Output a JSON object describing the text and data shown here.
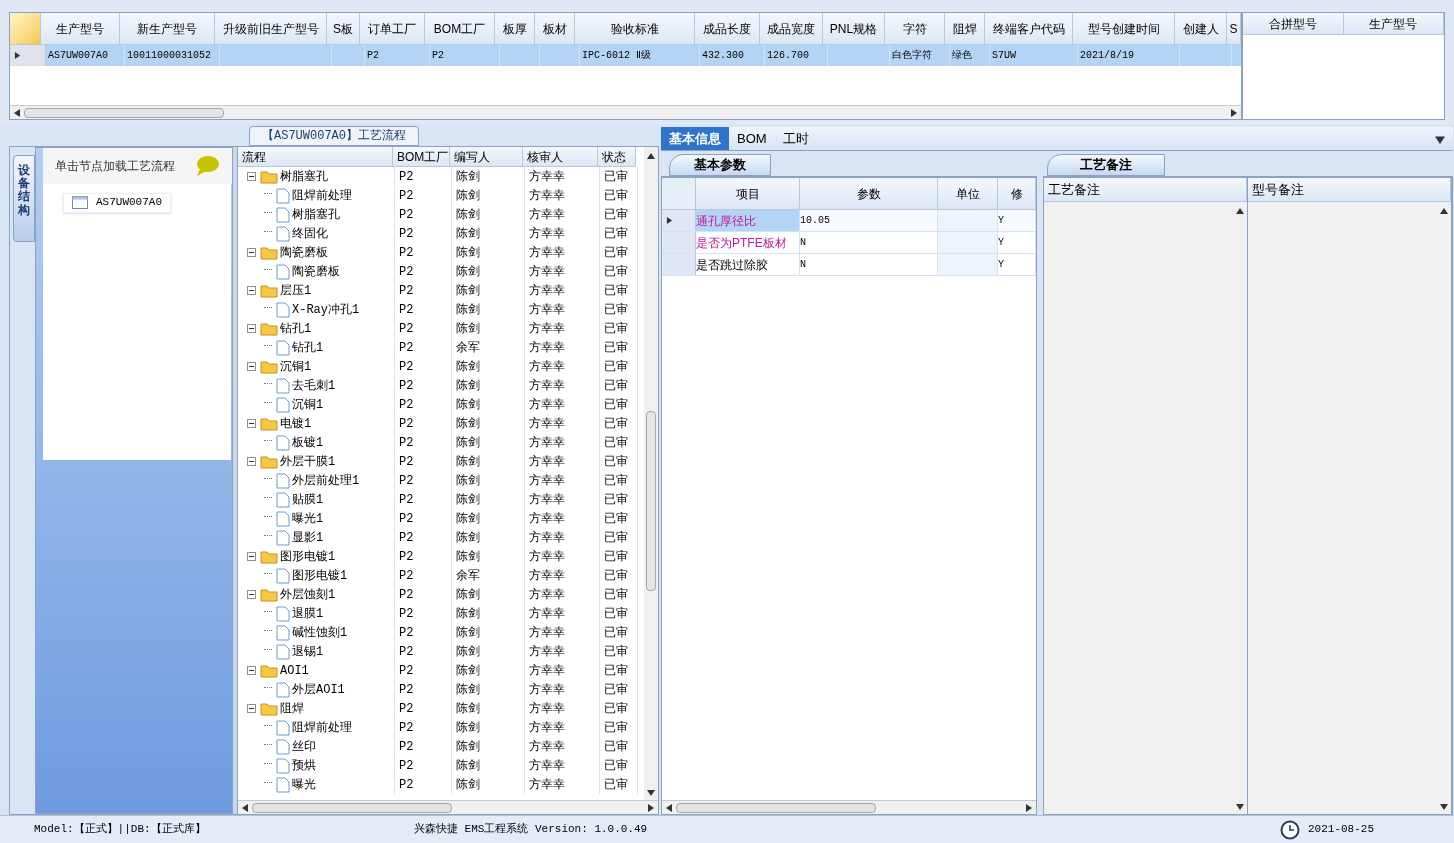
{
  "main_grid": {
    "columns": [
      "生产型号",
      "新生产型号",
      "升级前旧生产型号",
      "S板",
      "订单工厂",
      "BOM工厂",
      "板厚",
      "板材",
      "验收标准",
      "成品长度",
      "成品宽度",
      "PNL规格",
      "字符",
      "阻焊",
      "终端客户代码",
      "型号创建时间",
      "创建人",
      "S"
    ],
    "rows": [
      {
        "selected": true,
        "cells": [
          "AS7UW007A0",
          "10011000031052",
          "",
          "",
          "P2",
          "P2",
          "",
          "",
          "IPC-6012 Ⅱ级",
          "432.300",
          "126.700",
          "",
          "白色字符",
          "绿色",
          "S7UW",
          "2021/8/19",
          "",
          ""
        ]
      }
    ]
  },
  "merge_grid": {
    "columns": [
      "合拼型号",
      "生产型号"
    ]
  },
  "flow_panel": {
    "title": "【AS7UW007A0】工艺流程",
    "side_tab": "设备结构",
    "hint": "单击节点加载工艺流程",
    "tree": [
      {
        "label": "AS7UW007A0"
      }
    ]
  },
  "flow_grid": {
    "columns": [
      "流程",
      "BOM工厂",
      "编写人",
      "核审人",
      "状态"
    ],
    "nodes": [
      {
        "label": "树脂塞孔",
        "expanded": true,
        "cells": [
          "P2",
          "陈剑",
          "方幸幸",
          "已审"
        ],
        "children": [
          {
            "label": "阻焊前处理",
            "cells": [
              "P2",
              "陈剑",
              "方幸幸",
              "已审"
            ]
          },
          {
            "label": "树脂塞孔",
            "cells": [
              "P2",
              "陈剑",
              "方幸幸",
              "已审"
            ]
          },
          {
            "label": "终固化",
            "cells": [
              "P2",
              "陈剑",
              "方幸幸",
              "已审"
            ]
          }
        ]
      },
      {
        "label": "陶瓷磨板",
        "expanded": true,
        "cells": [
          "P2",
          "陈剑",
          "方幸幸",
          "已审"
        ],
        "children": [
          {
            "label": "陶瓷磨板",
            "cells": [
              "P2",
              "陈剑",
              "方幸幸",
              "已审"
            ]
          }
        ]
      },
      {
        "label": "层压1",
        "expanded": true,
        "cells": [
          "P2",
          "陈剑",
          "方幸幸",
          "已审"
        ],
        "children": [
          {
            "label": "X-Ray冲孔1",
            "cells": [
              "P2",
              "陈剑",
              "方幸幸",
              "已审"
            ]
          }
        ]
      },
      {
        "label": "钻孔1",
        "expanded": true,
        "cells": [
          "P2",
          "陈剑",
          "方幸幸",
          "已审"
        ],
        "children": [
          {
            "label": "钻孔1",
            "cells": [
              "P2",
              "余军",
              "方幸幸",
              "已审"
            ]
          }
        ]
      },
      {
        "label": "沉铜1",
        "expanded": true,
        "cells": [
          "P2",
          "陈剑",
          "方幸幸",
          "已审"
        ],
        "children": [
          {
            "label": "去毛刺1",
            "cells": [
              "P2",
              "陈剑",
              "方幸幸",
              "已审"
            ]
          },
          {
            "label": "沉铜1",
            "cells": [
              "P2",
              "陈剑",
              "方幸幸",
              "已审"
            ]
          }
        ]
      },
      {
        "label": "电镀1",
        "expanded": true,
        "cells": [
          "P2",
          "陈剑",
          "方幸幸",
          "已审"
        ],
        "children": [
          {
            "label": "板镀1",
            "cells": [
              "P2",
              "陈剑",
              "方幸幸",
              "已审"
            ]
          }
        ]
      },
      {
        "label": "外层干膜1",
        "expanded": true,
        "cells": [
          "P2",
          "陈剑",
          "方幸幸",
          "已审"
        ],
        "children": [
          {
            "label": "外层前处理1",
            "cells": [
              "P2",
              "陈剑",
              "方幸幸",
              "已审"
            ]
          },
          {
            "label": "贴膜1",
            "cells": [
              "P2",
              "陈剑",
              "方幸幸",
              "已审"
            ]
          },
          {
            "label": "曝光1",
            "cells": [
              "P2",
              "陈剑",
              "方幸幸",
              "已审"
            ]
          },
          {
            "label": "显影1",
            "cells": [
              "P2",
              "陈剑",
              "方幸幸",
              "已审"
            ]
          }
        ]
      },
      {
        "label": "图形电镀1",
        "expanded": true,
        "cells": [
          "P2",
          "陈剑",
          "方幸幸",
          "已审"
        ],
        "children": [
          {
            "label": "图形电镀1",
            "cells": [
              "P2",
              "余军",
              "方幸幸",
              "已审"
            ]
          }
        ]
      },
      {
        "label": "外层蚀刻1",
        "expanded": true,
        "cells": [
          "P2",
          "陈剑",
          "方幸幸",
          "已审"
        ],
        "children": [
          {
            "label": "退膜1",
            "cells": [
              "P2",
              "陈剑",
              "方幸幸",
              "已审"
            ]
          },
          {
            "label": "碱性蚀刻1",
            "cells": [
              "P2",
              "陈剑",
              "方幸幸",
              "已审"
            ]
          },
          {
            "label": "退锡1",
            "cells": [
              "P2",
              "陈剑",
              "方幸幸",
              "已审"
            ]
          }
        ]
      },
      {
        "label": "AOI1",
        "expanded": true,
        "cells": [
          "P2",
          "陈剑",
          "方幸幸",
          "已审"
        ],
        "children": [
          {
            "label": "外层AOI1",
            "cells": [
              "P2",
              "陈剑",
              "方幸幸",
              "已审"
            ]
          }
        ]
      },
      {
        "label": "阻焊",
        "expanded": true,
        "cells": [
          "P2",
          "陈剑",
          "方幸幸",
          "已审"
        ],
        "children": [
          {
            "label": "阻焊前处理",
            "cells": [
              "P2",
              "陈剑",
              "方幸幸",
              "已审"
            ]
          },
          {
            "label": "丝印",
            "cells": [
              "P2",
              "陈剑",
              "方幸幸",
              "已审"
            ]
          },
          {
            "label": "预烘",
            "cells": [
              "P2",
              "陈剑",
              "方幸幸",
              "已审"
            ]
          },
          {
            "label": "曝光",
            "cells": [
              "P2",
              "陈剑",
              "方幸幸",
              "已审"
            ]
          }
        ]
      }
    ]
  },
  "tabs": [
    {
      "label": "基本信息",
      "selected": true
    },
    {
      "label": "BOM",
      "selected": false
    },
    {
      "label": "工时",
      "selected": false
    }
  ],
  "params": {
    "tab": "基本参数",
    "columns": [
      "项目",
      "参数",
      "单位",
      "修"
    ],
    "rows": [
      {
        "selected": true,
        "highlighted": true,
        "cells": [
          "通孔厚径比",
          "10.05",
          "",
          "Y"
        ]
      },
      {
        "selected": false,
        "highlighted": true,
        "cells": [
          "是否为PTFE板材",
          "N",
          "",
          "Y"
        ]
      },
      {
        "selected": false,
        "highlighted": false,
        "cells": [
          "是否跳过除胶",
          "N",
          "",
          "Y"
        ]
      }
    ]
  },
  "notes": {
    "tab": "工艺备注",
    "columns": [
      "工艺备注",
      "型号备注"
    ]
  },
  "status_bar": {
    "mode": "Model:【正式】||DB:【正式库】",
    "app": "兴森快捷 EMS工程系统 Version: 1.0.0.49",
    "time": "2021-08-25"
  }
}
